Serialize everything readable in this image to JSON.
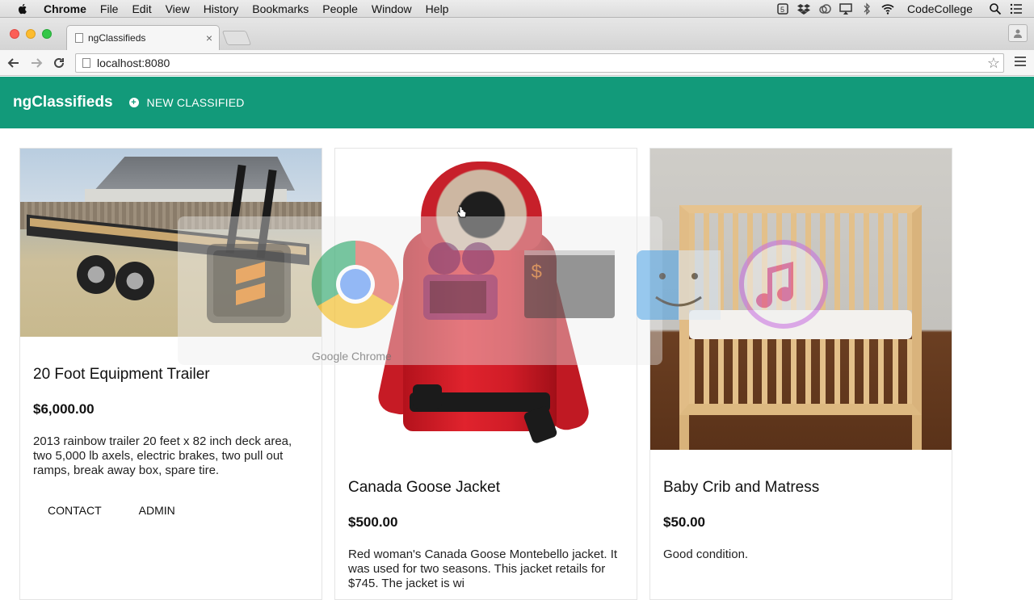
{
  "menubar": {
    "items": [
      "Chrome",
      "File",
      "Edit",
      "View",
      "History",
      "Bookmarks",
      "People",
      "Window",
      "Help"
    ],
    "user": "CodeCollege"
  },
  "browser": {
    "tab_title": "ngClassifieds",
    "url": "localhost:8080"
  },
  "app": {
    "title": "ngClassifieds",
    "new_button": "NEW CLASSIFIED"
  },
  "cards": [
    {
      "title": "20 Foot Equipment Trailer",
      "price": "$6,000.00",
      "description": "2013 rainbow trailer 20 feet x 82 inch deck area, two 5,000 lb axels, electric brakes, two pull out ramps, break away box, spare tire.",
      "contact": "CONTACT",
      "admin": "ADMIN"
    },
    {
      "title": "Canada Goose Jacket",
      "price": "$500.00",
      "description": "Red woman's Canada Goose Montebello jacket. It was used for two seasons. This jacket retails for $745. The jacket is wi"
    },
    {
      "title": "Baby Crib and Matress",
      "price": "$50.00",
      "description": "Good condition."
    }
  ],
  "switcher": {
    "label": "Google Chrome"
  }
}
